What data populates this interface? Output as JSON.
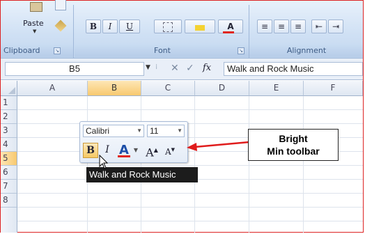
{
  "ribbon": {
    "clipboard": {
      "paste_label": "Paste",
      "group_label": "Clipboard"
    },
    "font": {
      "group_label": "Font",
      "bold": "B",
      "italic": "I",
      "underline": "U",
      "font_color_letter": "A"
    },
    "alignment": {
      "group_label": "Alignment"
    }
  },
  "formula_bar": {
    "name_box": "B5",
    "fx_label": "fx",
    "content": "Walk and Rock Music"
  },
  "grid": {
    "columns": [
      "A",
      "B",
      "C",
      "D",
      "E",
      "F"
    ],
    "selected_column": "B",
    "rows": [
      "1",
      "2",
      "3",
      "4",
      "5",
      "6",
      "7",
      "8"
    ],
    "selected_row": "5"
  },
  "mini_toolbar": {
    "font_name": "Calibri",
    "font_size": "11",
    "bold": "B",
    "italic": "I",
    "font_color": "A",
    "grow": "A",
    "shrink": "A"
  },
  "cell_text": "Walk and Rock Music",
  "callout": {
    "line1": "Bright",
    "line2": "Min toolbar"
  },
  "colors": {
    "arrow": "#e01c1c",
    "selection": "#f8c96f",
    "font_color_bar": "#e0261c"
  }
}
